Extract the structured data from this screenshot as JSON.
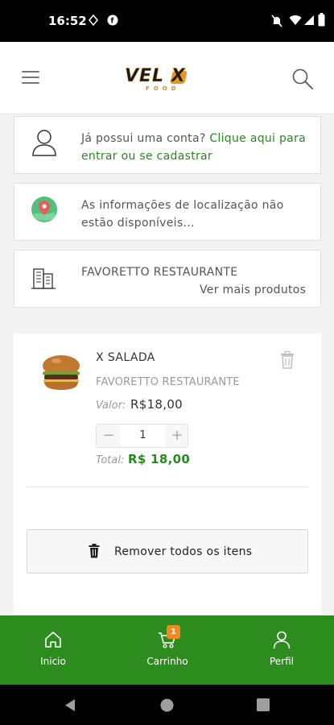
{
  "status_bar": {
    "time": "16:52"
  },
  "header": {
    "logo_text": "VEL X",
    "logo_sub": "FOOD"
  },
  "login_card": {
    "text": "Já possui uma conta? ",
    "link": "Clique aqui para entrar ou se cadastrar"
  },
  "location_card": {
    "text": "As informações de localização não estão disponíveis..."
  },
  "store_card": {
    "name": "FAVORETTO RESTAURANTE",
    "link": "Ver mais produtos"
  },
  "cart_item": {
    "name": "X SALADA",
    "restaurant": "FAVORETTO RESTAURANTE",
    "price_label": "Valor:",
    "price": "R$18,00",
    "quantity": "1",
    "total_label": "Total:",
    "total": "R$ 18,00"
  },
  "remove_all_label": "Remover todos os itens",
  "bottom_nav": {
    "items": [
      {
        "label": "Inicio",
        "icon": "home-icon"
      },
      {
        "label": "Carrinho",
        "icon": "cart-icon",
        "badge": "1"
      },
      {
        "label": "Perfil",
        "icon": "user-icon"
      }
    ]
  },
  "colors": {
    "accent": "#2c8c1e",
    "badge": "#f08a1c",
    "link": "#27891e"
  }
}
